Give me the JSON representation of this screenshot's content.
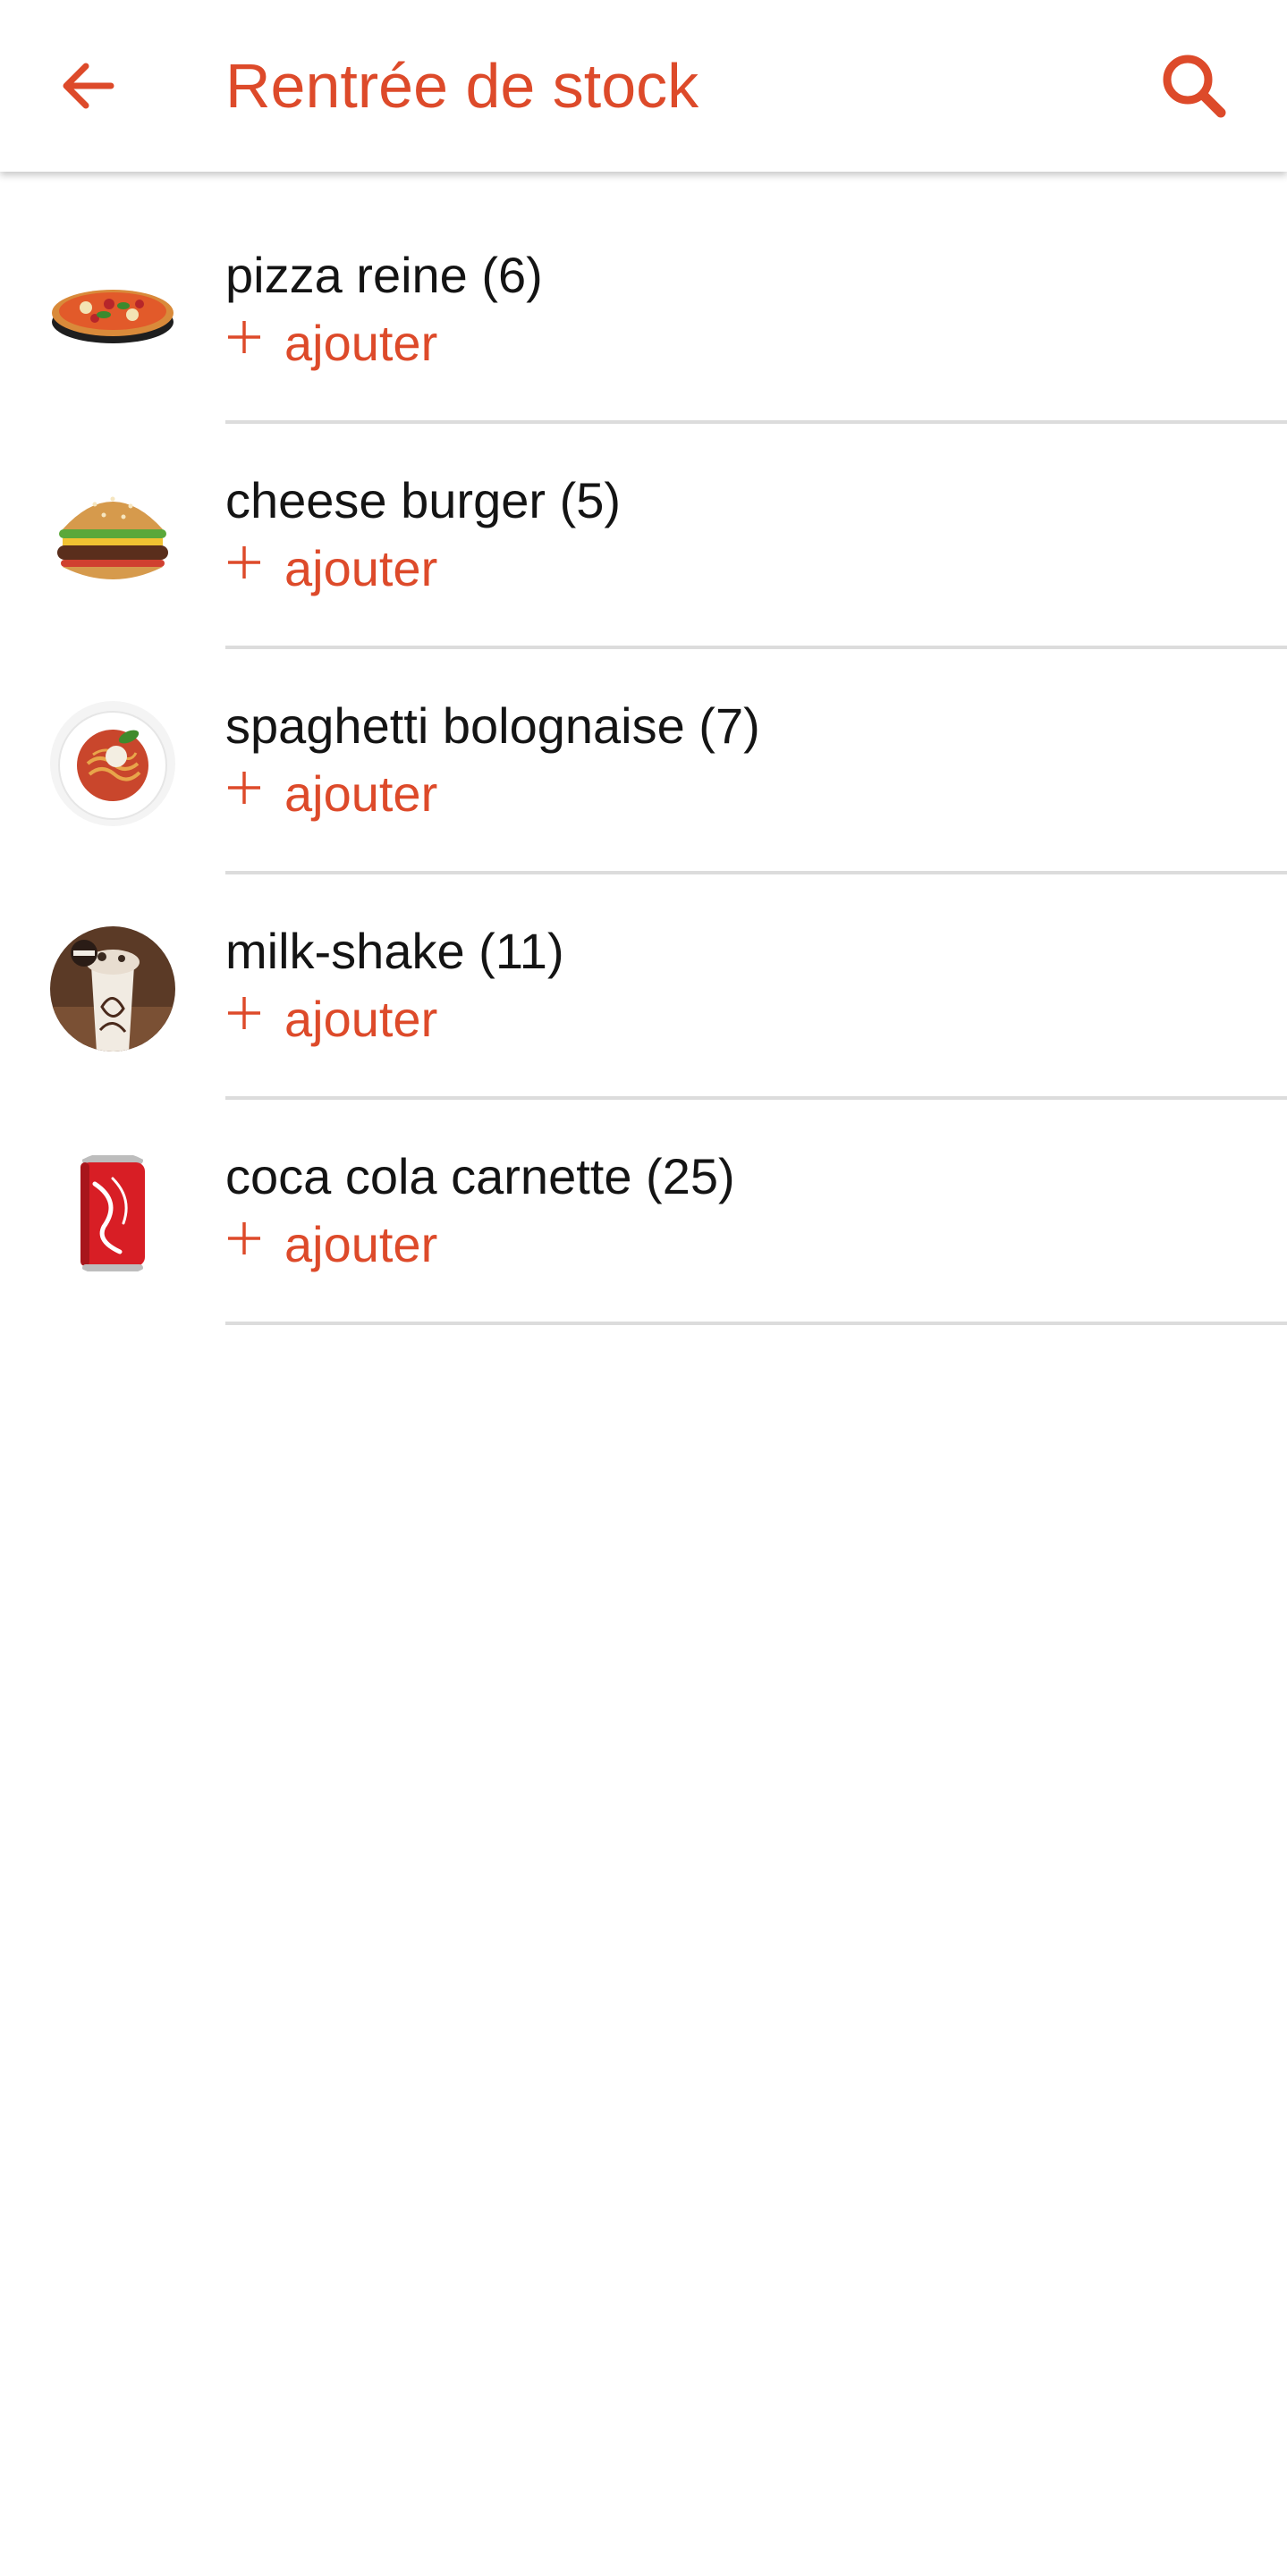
{
  "header": {
    "title": "Rentrée de stock",
    "back_icon": "arrow-left-icon",
    "search_icon": "search-icon"
  },
  "theme": {
    "accent": "#dd4a2a",
    "text": "#141414",
    "divider": "#dcdcdc"
  },
  "items": [
    {
      "label": "pizza reine (6)",
      "add_label": "ajouter",
      "image": "pizza-image",
      "add_icon": "plus-icon"
    },
    {
      "label": "cheese burger (5)",
      "add_label": "ajouter",
      "image": "burger-image",
      "add_icon": "plus-icon"
    },
    {
      "label": "spaghetti bolognaise (7)",
      "add_label": "ajouter",
      "image": "spaghetti-image",
      "add_icon": "plus-icon"
    },
    {
      "label": "milk-shake (11)",
      "add_label": "ajouter",
      "image": "milkshake-image",
      "add_icon": "plus-icon"
    },
    {
      "label": "coca cola carnette (25)",
      "add_label": "ajouter",
      "image": "cola-can-image",
      "add_icon": "plus-icon"
    }
  ]
}
